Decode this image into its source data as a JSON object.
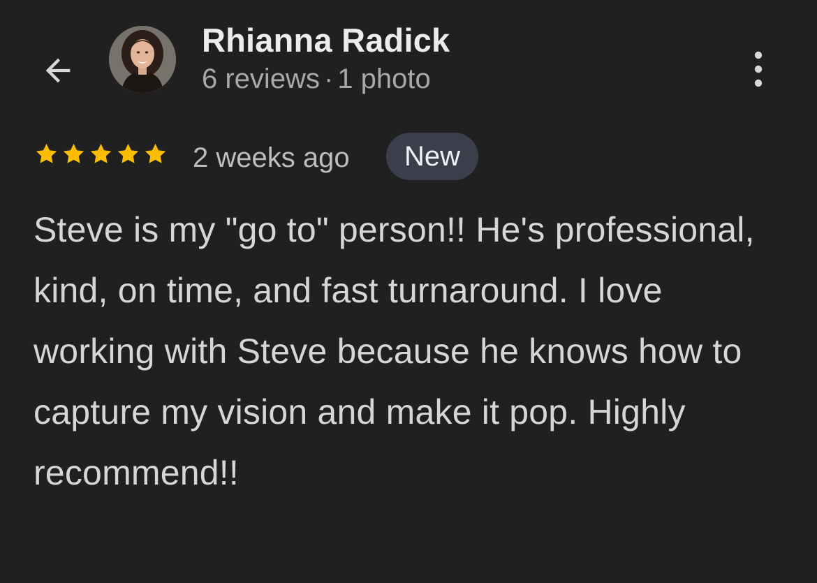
{
  "reviewer": {
    "name": "Rhianna Radick",
    "reviews_count": "6 reviews",
    "separator": "·",
    "photos_count": "1 photo"
  },
  "review": {
    "rating": 5,
    "max_rating": 5,
    "time": "2 weeks ago",
    "badge": "New",
    "text": "Steve is my \"go to\" person!! He's professional, kind, on time, and fast turnaround. I love working with Steve because he knows how to capture my vision and make it pop. Highly recommend!!"
  },
  "icons": {
    "back": "arrow-left-icon",
    "more": "more-vert-icon",
    "star": "star-icon"
  },
  "colors": {
    "background": "#202020",
    "star": "#fbbc04",
    "badge_bg": "#3a3f4b",
    "primary_text": "#ececec",
    "secondary_text": "#a9a9a9"
  }
}
